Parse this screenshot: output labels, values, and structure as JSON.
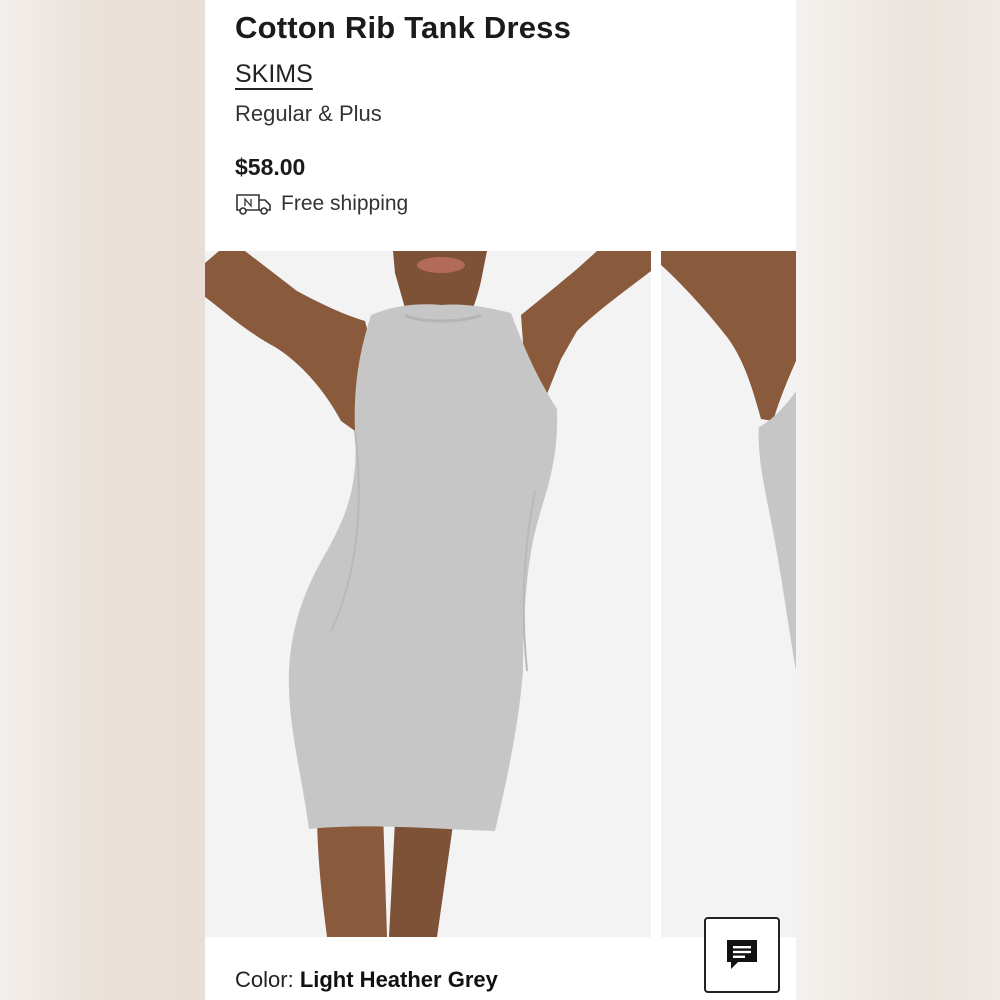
{
  "product": {
    "title": "Cotton Rib Tank Dress",
    "brand": "SKIMS",
    "size_range": "Regular & Plus",
    "price": "$58.00",
    "shipping": "Free shipping"
  },
  "selection": {
    "color_label": "Color:",
    "color_value": "Light Heather Grey"
  },
  "icons": {
    "shipping": "delivery-truck-icon",
    "chat": "chat-bubble-icon"
  },
  "colors": {
    "text": "#1b1b1b",
    "background": "#ffffff",
    "photo_background": "#f3f3f4",
    "dress": "#c6c6c6",
    "skin": "#8a5a3c"
  }
}
